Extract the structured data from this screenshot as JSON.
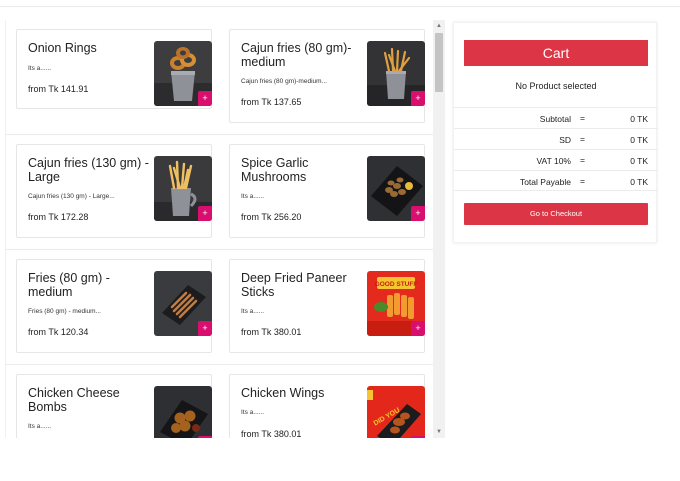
{
  "products": [
    {
      "name": "Onion Rings",
      "desc": "Its a......",
      "price": "from Tk 141.91",
      "image": "onion-rings"
    },
    {
      "name": "Cajun fries (80 gm)-medium",
      "desc": "Cajun fries (80 gm)-medium...",
      "price": "from Tk 137.65",
      "image": "cajun-fries-80"
    },
    {
      "name": "Cajun fries (130 gm) - Large",
      "desc": "Cajun fries (130 gm) - Large...",
      "price": "from Tk 172.28",
      "image": "cajun-fries-130"
    },
    {
      "name": "Spice Garlic Mushrooms",
      "desc": "Its a......",
      "price": "from Tk 256.20",
      "image": "garlic-mushrooms"
    },
    {
      "name": "Fries (80 gm) - medium",
      "desc": "Fries (80 gm) - medium...",
      "price": "from Tk 120.34",
      "image": "fries-80"
    },
    {
      "name": "Deep Fried Paneer Sticks",
      "desc": "Its a......",
      "price": "from Tk 380.01",
      "image": "paneer-sticks",
      "image_text": "GOOD STUFF"
    },
    {
      "name": "Chicken Cheese Bombs",
      "desc": "Its a......",
      "price": "",
      "image": "cheese-bombs"
    },
    {
      "name": "Chicken Wings",
      "desc": "Its a......",
      "price": "from Tk 380.01",
      "image": "chicken-wings",
      "image_text": "DID YOU"
    }
  ],
  "add_label": "+",
  "scrollbar": {
    "up": "▲",
    "down": "▼"
  },
  "cart": {
    "title": "Cart",
    "empty_message": "No Product selected",
    "summary": [
      {
        "label": "Subtotal",
        "eq": "=",
        "amount": "0 TK"
      },
      {
        "label": "SD",
        "eq": "=",
        "amount": "0 TK"
      },
      {
        "label": "VAT 10%",
        "eq": "=",
        "amount": "0 TK"
      },
      {
        "label": "Total Payable",
        "eq": "=",
        "amount": "0 TK"
      }
    ],
    "checkout_label": "Go to Checkout"
  },
  "colors": {
    "accent": "#dc3545",
    "add_button": "#d80f6f"
  }
}
